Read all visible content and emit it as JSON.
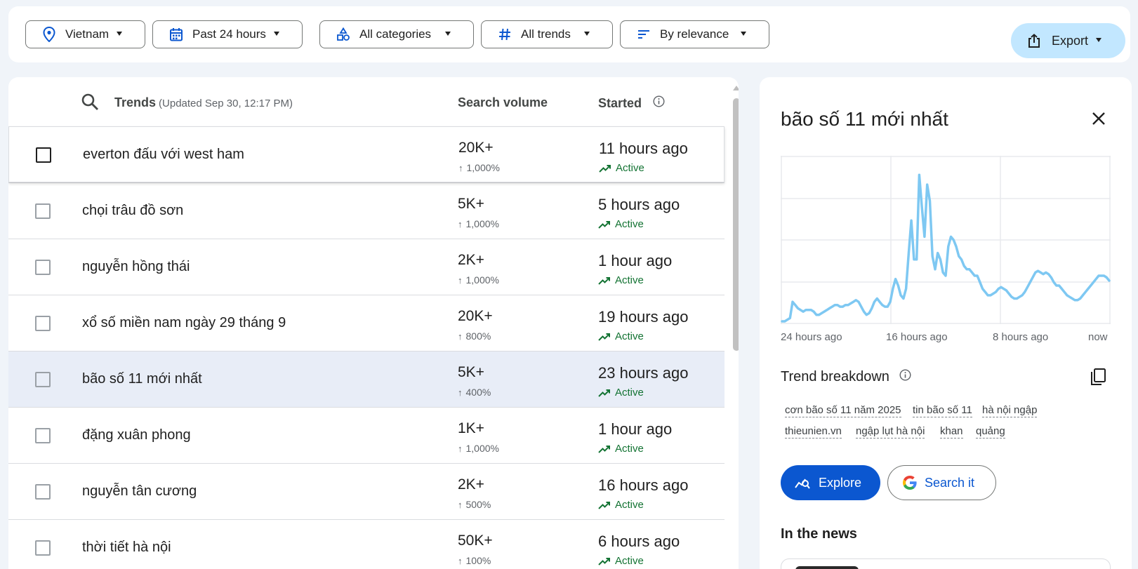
{
  "filters": {
    "location": "Vietnam",
    "time": "Past 24 hours",
    "category": "All categories",
    "trends": "All trends",
    "sort": "By relevance",
    "export": "Export"
  },
  "table": {
    "title": "Trends",
    "updated": "(Updated Sep 30, 12:17 PM)",
    "col_volume": "Search volume",
    "col_started": "Started",
    "rows": [
      {
        "term": "everton đấu với west ham",
        "volume": "20K+",
        "pct": "1,000%",
        "started": "11 hours ago",
        "status": "Active"
      },
      {
        "term": "chọi trâu đồ sơn",
        "volume": "5K+",
        "pct": "1,000%",
        "started": "5 hours ago",
        "status": "Active"
      },
      {
        "term": "nguyễn hồng thái",
        "volume": "2K+",
        "pct": "1,000%",
        "started": "1 hour ago",
        "status": "Active"
      },
      {
        "term": "xổ số miền nam ngày 29 tháng 9",
        "volume": "20K+",
        "pct": "800%",
        "started": "19 hours ago",
        "status": "Active"
      },
      {
        "term": "bão số 11 mới nhất",
        "volume": "5K+",
        "pct": "400%",
        "started": "23 hours ago",
        "status": "Active"
      },
      {
        "term": "đặng xuân phong",
        "volume": "1K+",
        "pct": "1,000%",
        "started": "1 hour ago",
        "status": "Active"
      },
      {
        "term": "nguyễn tân cương",
        "volume": "2K+",
        "pct": "500%",
        "started": "16 hours ago",
        "status": "Active"
      },
      {
        "term": "thời tiết hà nội",
        "volume": "50K+",
        "pct": "100%",
        "started": "6 hours ago",
        "status": "Active"
      }
    ]
  },
  "panel": {
    "title": "bão số 11 mới nhất",
    "x_labels": [
      "24 hours ago",
      "16 hours ago",
      "8 hours ago",
      "now"
    ],
    "breakdown_title": "Trend breakdown",
    "chips": [
      "cơn bão số 11 năm 2025",
      "tin bão số 11",
      "hà nội ngập",
      "thieunien.vn",
      "ngập lụt hà nội",
      "khan",
      "quảng"
    ],
    "explore": "Explore",
    "search": "Search it",
    "news_title": "In the news"
  },
  "chart_data": {
    "type": "line",
    "x": [
      "24 hours ago",
      "16 hours ago",
      "8 hours ago",
      "now"
    ],
    "series": [
      {
        "values": [
          0,
          0,
          1,
          2,
          12,
          10,
          8,
          7,
          6,
          7,
          7,
          7,
          6,
          4,
          4,
          5,
          6,
          7,
          8,
          9,
          10,
          10,
          9,
          9,
          10,
          10,
          11,
          12,
          13,
          12,
          9,
          6,
          4,
          5,
          8,
          12,
          14,
          12,
          10,
          9,
          9,
          12,
          20,
          26,
          22,
          16,
          14,
          20,
          42,
          62,
          38,
          38,
          90,
          70,
          52,
          84,
          74,
          40,
          32,
          42,
          38,
          30,
          28,
          46,
          52,
          50,
          46,
          40,
          38,
          34,
          32,
          32,
          30,
          28,
          28,
          24,
          20,
          18,
          16,
          16,
          17,
          18,
          20,
          21,
          20,
          19,
          17,
          15,
          14,
          14,
          15,
          16,
          18,
          21,
          24,
          27,
          30,
          31,
          30,
          29,
          30,
          29,
          27,
          24,
          22,
          22,
          20,
          18,
          16,
          15,
          14,
          13,
          13,
          14,
          16,
          18,
          20,
          22,
          24,
          26,
          28,
          28,
          28,
          27,
          25
        ]
      }
    ],
    "ylim": [
      0,
      100
    ],
    "grid": true
  },
  "colors": {
    "accent": "#0b57d0",
    "line": "#7ec8f2",
    "active": "#137333",
    "export_bg": "#c2e7ff",
    "selected_row": "#e8edf7"
  }
}
